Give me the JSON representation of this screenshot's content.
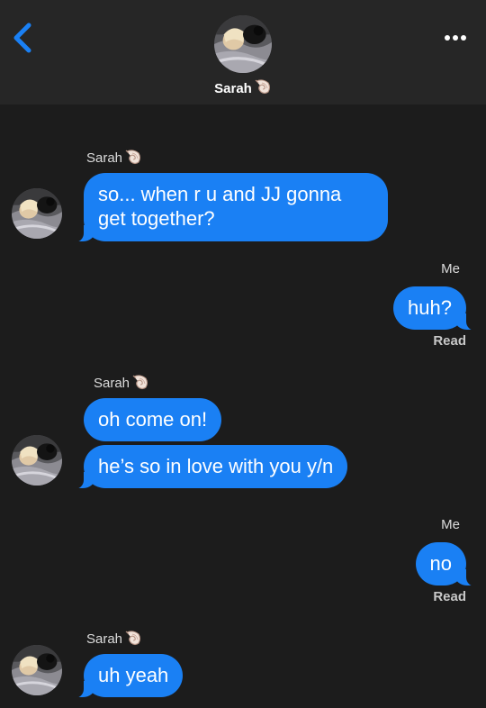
{
  "header": {
    "contact_name": "Sarah",
    "contact_emoji_icon": "spiral-shell-icon",
    "back_icon": "chevron-left-icon",
    "more_icon": "ellipsis-icon"
  },
  "colors": {
    "background": "#1c1c1c",
    "header_background": "#262626",
    "bubble": "#1a80f4",
    "back_chevron": "#1a80f4"
  },
  "messages": [
    {
      "sender": "Sarah",
      "lines": [
        "so... when r u and JJ gonna",
        "get together?"
      ]
    },
    {
      "sender": "Me",
      "text": "huh?",
      "status": "Read"
    },
    {
      "sender": "Sarah",
      "texts": [
        "oh come on!",
        "he’s so in love with you y/n"
      ]
    },
    {
      "sender": "Me",
      "text": "no",
      "status": "Read"
    },
    {
      "sender": "Sarah",
      "text": "uh yeah"
    }
  ]
}
